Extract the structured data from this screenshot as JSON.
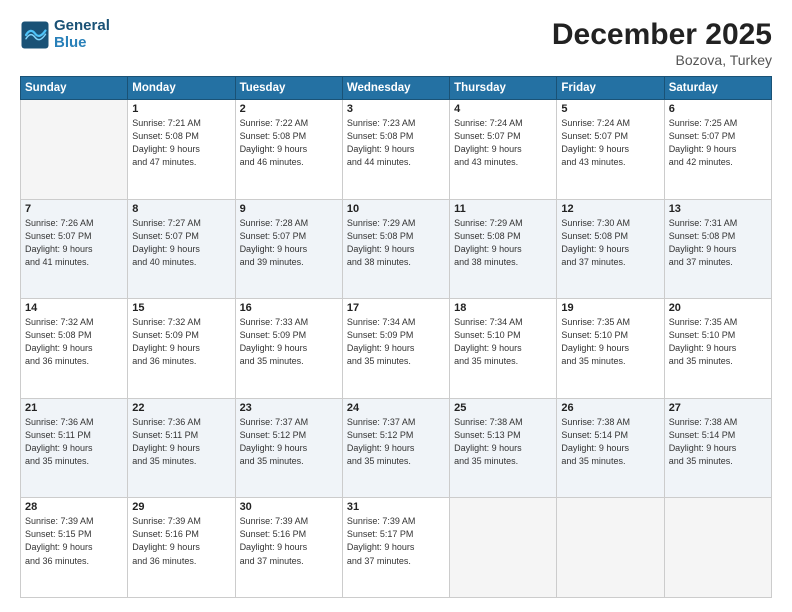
{
  "header": {
    "logo_line1": "General",
    "logo_line2": "Blue",
    "month": "December 2025",
    "location": "Bozova, Turkey"
  },
  "weekdays": [
    "Sunday",
    "Monday",
    "Tuesday",
    "Wednesday",
    "Thursday",
    "Friday",
    "Saturday"
  ],
  "weeks": [
    {
      "shade": "white",
      "days": [
        {
          "num": "",
          "info": ""
        },
        {
          "num": "1",
          "info": "Sunrise: 7:21 AM\nSunset: 5:08 PM\nDaylight: 9 hours\nand 47 minutes."
        },
        {
          "num": "2",
          "info": "Sunrise: 7:22 AM\nSunset: 5:08 PM\nDaylight: 9 hours\nand 46 minutes."
        },
        {
          "num": "3",
          "info": "Sunrise: 7:23 AM\nSunset: 5:08 PM\nDaylight: 9 hours\nand 44 minutes."
        },
        {
          "num": "4",
          "info": "Sunrise: 7:24 AM\nSunset: 5:07 PM\nDaylight: 9 hours\nand 43 minutes."
        },
        {
          "num": "5",
          "info": "Sunrise: 7:24 AM\nSunset: 5:07 PM\nDaylight: 9 hours\nand 43 minutes."
        },
        {
          "num": "6",
          "info": "Sunrise: 7:25 AM\nSunset: 5:07 PM\nDaylight: 9 hours\nand 42 minutes."
        }
      ]
    },
    {
      "shade": "shaded",
      "days": [
        {
          "num": "7",
          "info": "Sunrise: 7:26 AM\nSunset: 5:07 PM\nDaylight: 9 hours\nand 41 minutes."
        },
        {
          "num": "8",
          "info": "Sunrise: 7:27 AM\nSunset: 5:07 PM\nDaylight: 9 hours\nand 40 minutes."
        },
        {
          "num": "9",
          "info": "Sunrise: 7:28 AM\nSunset: 5:07 PM\nDaylight: 9 hours\nand 39 minutes."
        },
        {
          "num": "10",
          "info": "Sunrise: 7:29 AM\nSunset: 5:08 PM\nDaylight: 9 hours\nand 38 minutes."
        },
        {
          "num": "11",
          "info": "Sunrise: 7:29 AM\nSunset: 5:08 PM\nDaylight: 9 hours\nand 38 minutes."
        },
        {
          "num": "12",
          "info": "Sunrise: 7:30 AM\nSunset: 5:08 PM\nDaylight: 9 hours\nand 37 minutes."
        },
        {
          "num": "13",
          "info": "Sunrise: 7:31 AM\nSunset: 5:08 PM\nDaylight: 9 hours\nand 37 minutes."
        }
      ]
    },
    {
      "shade": "white",
      "days": [
        {
          "num": "14",
          "info": "Sunrise: 7:32 AM\nSunset: 5:08 PM\nDaylight: 9 hours\nand 36 minutes."
        },
        {
          "num": "15",
          "info": "Sunrise: 7:32 AM\nSunset: 5:09 PM\nDaylight: 9 hours\nand 36 minutes."
        },
        {
          "num": "16",
          "info": "Sunrise: 7:33 AM\nSunset: 5:09 PM\nDaylight: 9 hours\nand 35 minutes."
        },
        {
          "num": "17",
          "info": "Sunrise: 7:34 AM\nSunset: 5:09 PM\nDaylight: 9 hours\nand 35 minutes."
        },
        {
          "num": "18",
          "info": "Sunrise: 7:34 AM\nSunset: 5:10 PM\nDaylight: 9 hours\nand 35 minutes."
        },
        {
          "num": "19",
          "info": "Sunrise: 7:35 AM\nSunset: 5:10 PM\nDaylight: 9 hours\nand 35 minutes."
        },
        {
          "num": "20",
          "info": "Sunrise: 7:35 AM\nSunset: 5:10 PM\nDaylight: 9 hours\nand 35 minutes."
        }
      ]
    },
    {
      "shade": "shaded",
      "days": [
        {
          "num": "21",
          "info": "Sunrise: 7:36 AM\nSunset: 5:11 PM\nDaylight: 9 hours\nand 35 minutes."
        },
        {
          "num": "22",
          "info": "Sunrise: 7:36 AM\nSunset: 5:11 PM\nDaylight: 9 hours\nand 35 minutes."
        },
        {
          "num": "23",
          "info": "Sunrise: 7:37 AM\nSunset: 5:12 PM\nDaylight: 9 hours\nand 35 minutes."
        },
        {
          "num": "24",
          "info": "Sunrise: 7:37 AM\nSunset: 5:12 PM\nDaylight: 9 hours\nand 35 minutes."
        },
        {
          "num": "25",
          "info": "Sunrise: 7:38 AM\nSunset: 5:13 PM\nDaylight: 9 hours\nand 35 minutes."
        },
        {
          "num": "26",
          "info": "Sunrise: 7:38 AM\nSunset: 5:14 PM\nDaylight: 9 hours\nand 35 minutes."
        },
        {
          "num": "27",
          "info": "Sunrise: 7:38 AM\nSunset: 5:14 PM\nDaylight: 9 hours\nand 35 minutes."
        }
      ]
    },
    {
      "shade": "white",
      "days": [
        {
          "num": "28",
          "info": "Sunrise: 7:39 AM\nSunset: 5:15 PM\nDaylight: 9 hours\nand 36 minutes."
        },
        {
          "num": "29",
          "info": "Sunrise: 7:39 AM\nSunset: 5:16 PM\nDaylight: 9 hours\nand 36 minutes."
        },
        {
          "num": "30",
          "info": "Sunrise: 7:39 AM\nSunset: 5:16 PM\nDaylight: 9 hours\nand 37 minutes."
        },
        {
          "num": "31",
          "info": "Sunrise: 7:39 AM\nSunset: 5:17 PM\nDaylight: 9 hours\nand 37 minutes."
        },
        {
          "num": "",
          "info": ""
        },
        {
          "num": "",
          "info": ""
        },
        {
          "num": "",
          "info": ""
        }
      ]
    }
  ]
}
